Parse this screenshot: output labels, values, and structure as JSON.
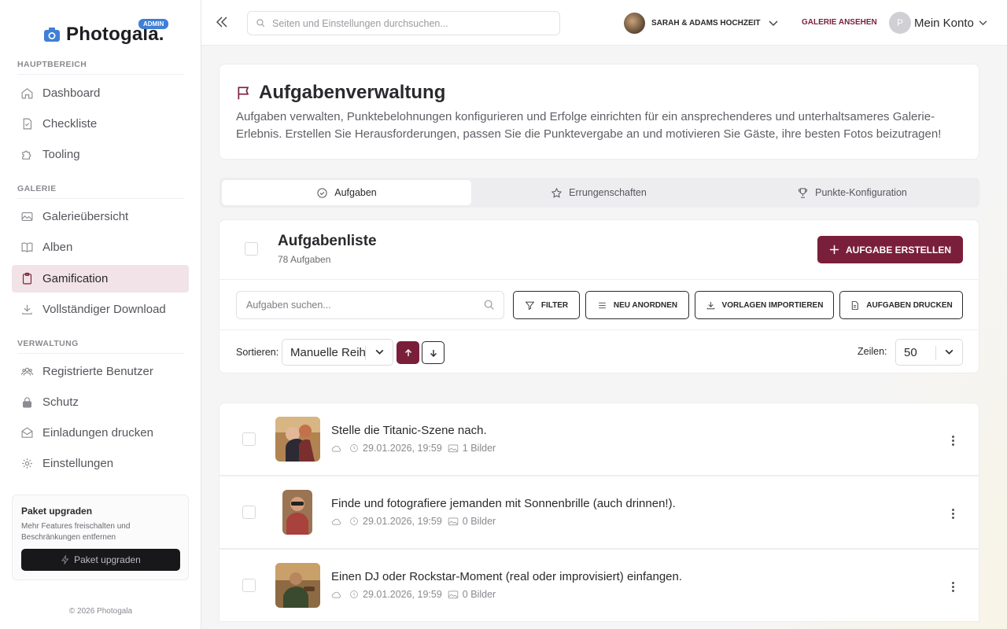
{
  "sidebar": {
    "logo_text": "Photogala.",
    "admin_badge": "ADMIN",
    "sections": [
      {
        "label": "HAUPTBEREICH"
      },
      {
        "label": "GALERIE"
      },
      {
        "label": "VERWALTUNG"
      }
    ],
    "items": [
      {
        "label": "Dashboard",
        "icon": "home-icon"
      },
      {
        "label": "Checkliste",
        "icon": "checklist-icon"
      },
      {
        "label": "Tooling",
        "icon": "puzzle-icon"
      },
      {
        "label": "Galerieübersicht",
        "icon": "image-icon"
      },
      {
        "label": "Alben",
        "icon": "book-icon"
      },
      {
        "label": "Gamification",
        "icon": "clipboard-icon",
        "active": true
      },
      {
        "label": "Vollständiger Download",
        "icon": "download-icon"
      },
      {
        "label": "Registrierte Benutzer",
        "icon": "users-icon"
      },
      {
        "label": "Schutz",
        "icon": "lock-icon"
      },
      {
        "label": "Einladungen drucken",
        "icon": "mail-icon"
      },
      {
        "label": "Einstellungen",
        "icon": "gear-icon"
      }
    ],
    "upgrade": {
      "title": "Paket upgraden",
      "description": "Mehr Features freischalten und Beschränkungen entfernen",
      "button": "Paket upgraden"
    },
    "copyright": "© 2026 Photogala"
  },
  "topbar": {
    "search_placeholder": "Seiten und Einstellungen durchsuchen...",
    "event_name": "SARAH & ADAMS HOCHZEIT",
    "galerie_link": "GALERIE ANSEHEN",
    "account_initial": "P",
    "account_label": "Mein Konto"
  },
  "header": {
    "title": "Aufgabenverwaltung",
    "description": "Aufgaben verwalten, Punktebelohnungen konfigurieren und Erfolge einrichten für ein ansprechenderes und unterhaltsameres Galerie-Erlebnis. Erstellen Sie Herausforderungen, passen Sie die Punktevergabe an und motivieren Sie Gäste, ihre besten Fotos beizutragen!"
  },
  "tabs": [
    {
      "label": "Aufgaben",
      "active": true
    },
    {
      "label": "Errungenschaften"
    },
    {
      "label": "Punkte-Konfiguration"
    }
  ],
  "tasklist": {
    "title": "Aufgabenliste",
    "count": "78 Aufgaben",
    "create_button": "AUFGABE ERSTELLEN",
    "search_placeholder": "Aufgaben suchen...",
    "buttons": {
      "filter": "FILTER",
      "reorder": "NEU ANORDNEN",
      "import": "VORLAGEN IMPORTIEREN",
      "print": "AUFGABEN DRUCKEN"
    },
    "sort_label": "Sortieren:",
    "sort_value": "Manuelle Reihenfolge",
    "rows_label": "Zeilen:",
    "rows_value": "50"
  },
  "tasks": [
    {
      "title": "Stelle die Titanic-Szene nach.",
      "date": "29.01.2026, 19:59",
      "images": "1 Bilder"
    },
    {
      "title": "Finde und fotografiere jemanden mit Sonnenbrille (auch drinnen!).",
      "date": "29.01.2026, 19:59",
      "images": "0 Bilder"
    },
    {
      "title": "Einen DJ oder Rockstar-Moment (real oder improvisiert) einfangen.",
      "date": "29.01.2026, 19:59",
      "images": "0 Bilder"
    }
  ],
  "colors": {
    "accent": "#7a1f3a",
    "admin_badge": "#3f7fd6",
    "active_nav_bg": "#f1e3e7"
  }
}
